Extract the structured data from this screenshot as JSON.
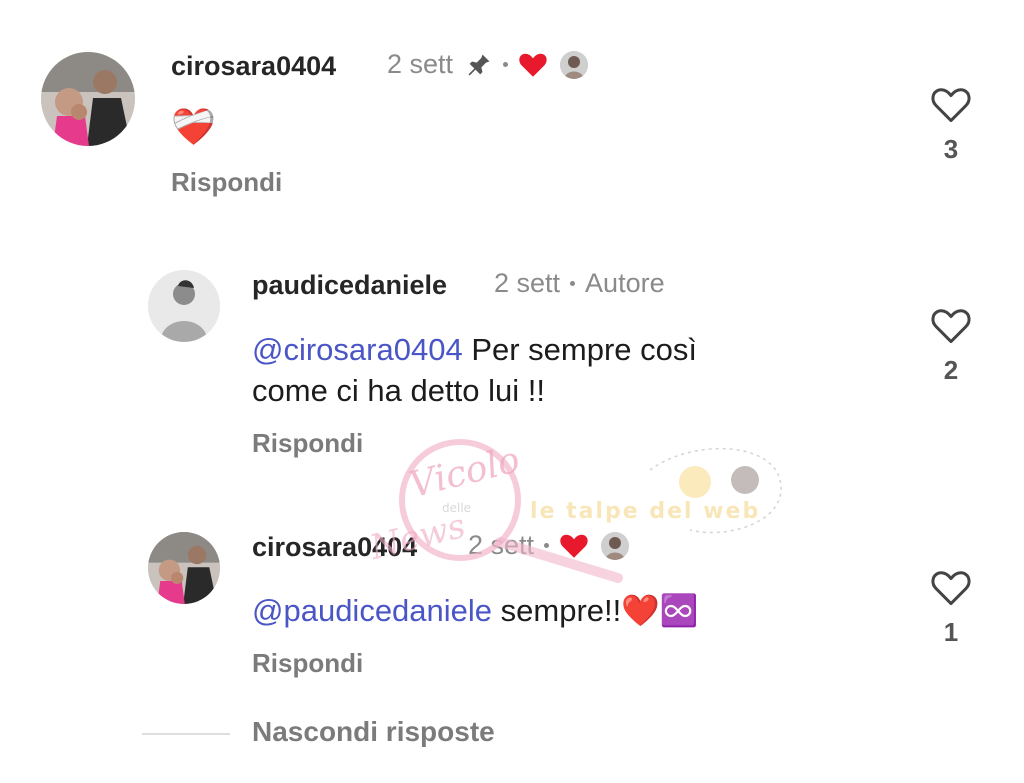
{
  "comments": [
    {
      "username": "cirosara0404",
      "time": "2 sett",
      "pinned": true,
      "liked_by_author": true,
      "body": "❤️‍🩹",
      "reply_label": "Rispondi",
      "likes": "3"
    },
    {
      "username": "paudicedaniele",
      "time": "2 sett",
      "role": "Autore",
      "mention": "@cirosara0404",
      "body_line1": " Per sempre così",
      "body_line2": "come ci ha detto lui !!",
      "reply_label": "Rispondi",
      "likes": "2"
    },
    {
      "username": "cirosara0404",
      "time": "2 sett",
      "liked_by_author": true,
      "mention": "@paudicedaniele",
      "body": " sempre!!",
      "emoji": "❤️♾️",
      "reply_label": "Rispondi",
      "likes": "1"
    }
  ],
  "hide_replies_label": "Nascondi risposte",
  "watermark": {
    "text1": "Vicolo",
    "text2": "delle",
    "text3": "News",
    "text4": "le talpe del web"
  },
  "colors": {
    "mention": "#4a56c6",
    "heart": "#e8192c",
    "secondary_text": "#8a8a8a"
  },
  "icons": [
    "heart-outline-icon",
    "pin-icon",
    "heart-filled-icon",
    "mention-icon"
  ]
}
